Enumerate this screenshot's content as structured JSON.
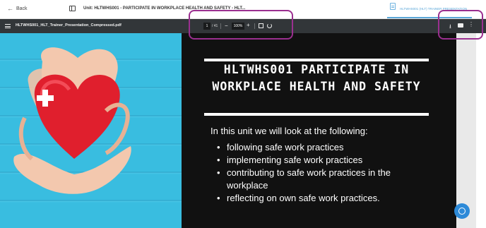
{
  "header": {
    "back_label": "Back",
    "unit_title": "Unit: HLTWHS001 - PARTICIPATE IN WORKPLACE HEALTH AND SAFETY - HLT...",
    "doc_tab_label": "HLTWHS001 (HLT) TRAINER PRESENTATION"
  },
  "pdf_toolbar": {
    "filename": "HLTWHS001_HLT_Trainer_Presentation_Compressed.pdf",
    "current_page": "1",
    "total_pages": "/ 41",
    "zoom": "100%"
  },
  "slide": {
    "title": "HLTWHS001 PARTICIPATE IN WORKPLACE HEALTH AND SAFETY",
    "intro": "In this unit we will look at the following:",
    "bullets": [
      "following safe work practices",
      "implementing safe work practices",
      "contributing to safe work practices in the workplace",
      "reflecting on own safe work practices."
    ]
  },
  "colors": {
    "highlight": "#9a2f8f",
    "accent": "#5aa7d8",
    "pdf_toolbar": "#323639",
    "heart": "#e01f2d"
  },
  "icons": {
    "back": "arrow-left-icon",
    "layout": "sidebar-layout-icon",
    "menu": "hamburger-menu-icon",
    "download": "download-icon",
    "print": "print-icon",
    "more": "more-vertical-icon",
    "help": "chat-help-icon"
  }
}
